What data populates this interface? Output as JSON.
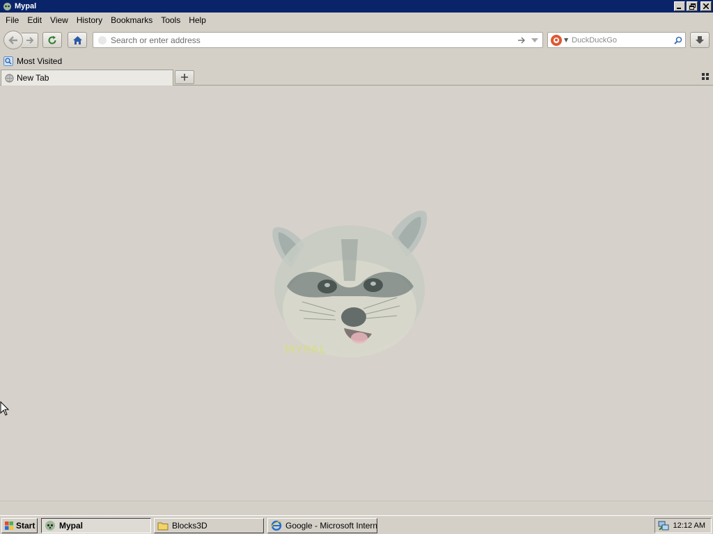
{
  "window": {
    "title": "Mypal",
    "controls": {
      "minimize": "_",
      "restore": "❐",
      "close": "✕"
    }
  },
  "menu": [
    "File",
    "Edit",
    "View",
    "History",
    "Bookmarks",
    "Tools",
    "Help"
  ],
  "navbar": {
    "url_placeholder": "Search or enter address",
    "url_value": "",
    "search_placeholder": "DuckDuckGo",
    "search_engine": "duckduckgo-icon",
    "icons": [
      "back-arrow-icon",
      "forward-arrow-icon",
      "reload-icon",
      "home-icon",
      "go-arrow-icon",
      "dropdown-icon",
      "magnifier-icon",
      "download-icon"
    ]
  },
  "bookmarks": {
    "most_visited": "Most Visited"
  },
  "tabs": [
    {
      "label": "New Tab",
      "active": true
    }
  ],
  "content": {
    "logo": "raccoon-logo",
    "logo_text": "MYPAL"
  },
  "taskbar": {
    "start_label": "Start",
    "tasks": [
      {
        "label": "Mypal",
        "active": true,
        "icon": "mypal-icon"
      },
      {
        "label": "Blocks3D",
        "active": false,
        "icon": "folder-icon"
      },
      {
        "label": "Google - Microsoft Intern...",
        "active": false,
        "icon": "ie-icon"
      }
    ],
    "clock": "12:12 AM"
  },
  "colors": {
    "titlebar": "#0a246a",
    "chrome": "#d4d0c8",
    "content_bg": "#d6d2cb"
  }
}
